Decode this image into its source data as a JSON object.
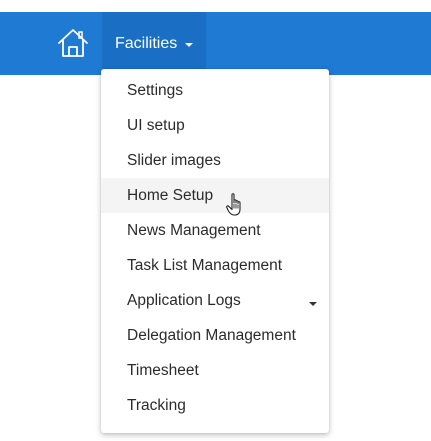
{
  "nav": {
    "home_icon": "home-icon",
    "facilities_label": "Facilities",
    "accent_color": "#1f7ad4"
  },
  "menu": {
    "items": [
      {
        "label": "Settings"
      },
      {
        "label": "UI setup"
      },
      {
        "label": "Slider images"
      },
      {
        "label": "Home Setup",
        "hovered": true
      },
      {
        "label": "News Management"
      },
      {
        "label": "Task List Management"
      },
      {
        "label": "Application Logs",
        "has_submenu": true
      },
      {
        "label": "Delegation Management"
      },
      {
        "label": "Timesheet"
      },
      {
        "label": "Tracking"
      }
    ]
  },
  "cursor": {
    "icon": "hand-pointer-icon"
  }
}
